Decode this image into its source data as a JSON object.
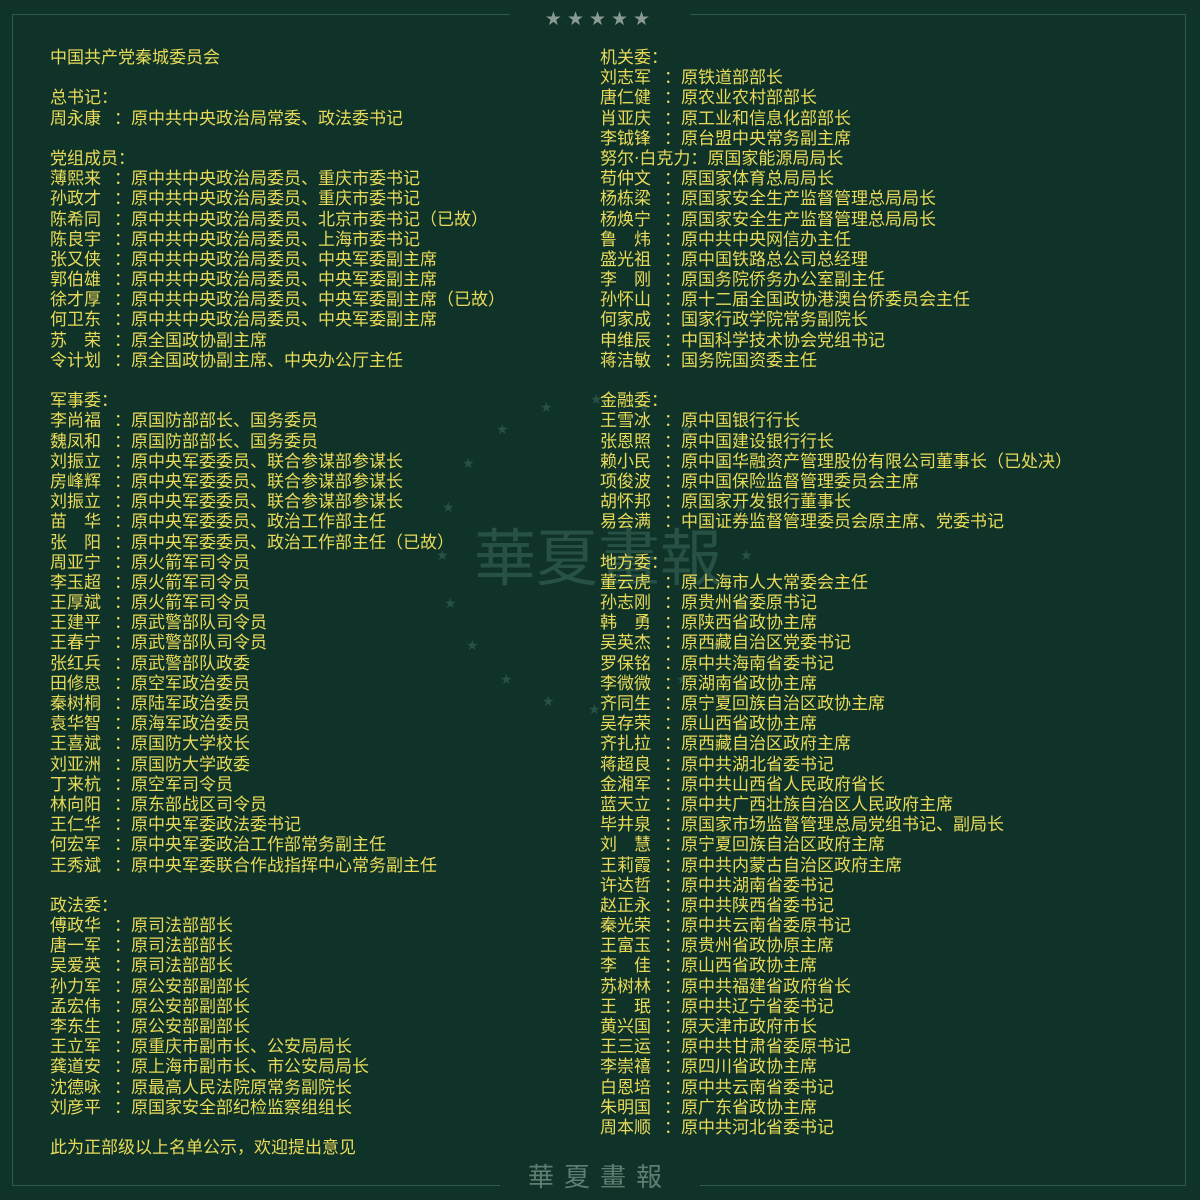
{
  "header": {
    "stars": "★★★★★"
  },
  "footer": {
    "logo_text": "華夏畫報"
  },
  "watermark": {
    "text": "華夏畫報"
  },
  "left": [
    {
      "type": "text",
      "text": "中国共产党秦城委员会"
    },
    {
      "type": "blank"
    },
    {
      "type": "heading",
      "text": "总书记："
    },
    {
      "type": "person",
      "name": "周永康",
      "title": "原中共中央政治局常委、政法委书记"
    },
    {
      "type": "blank"
    },
    {
      "type": "heading",
      "text": "党组成员："
    },
    {
      "type": "person",
      "name": "薄熙来",
      "title": "原中共中央政治局委员、重庆市委书记"
    },
    {
      "type": "person",
      "name": "孙政才",
      "title": "原中共中央政治局委员、重庆市委书记"
    },
    {
      "type": "person",
      "name": "陈希同",
      "title": "原中共中央政治局委员、北京市委书记（已故）"
    },
    {
      "type": "person",
      "name": "陈良宇",
      "title": "原中共中央政治局委员、上海市委书记"
    },
    {
      "type": "person",
      "name": "张又侠",
      "title": "原中共中央政治局委员、中央军委副主席"
    },
    {
      "type": "person",
      "name": "郭伯雄",
      "title": "原中共中央政治局委员、中央军委副主席"
    },
    {
      "type": "person",
      "name": "徐才厚",
      "title": "原中共中央政治局委员、中央军委副主席（已故）"
    },
    {
      "type": "person",
      "name": "何卫东",
      "title": "原中共中央政治局委员、中央军委副主席"
    },
    {
      "type": "person",
      "name": "苏　荣",
      "title": "原全国政协副主席"
    },
    {
      "type": "person",
      "name": "令计划",
      "title": "原全国政协副主席、中央办公厅主任"
    },
    {
      "type": "blank"
    },
    {
      "type": "heading",
      "text": "军事委："
    },
    {
      "type": "person",
      "name": "李尚福",
      "title": "原国防部部长、国务委员"
    },
    {
      "type": "person",
      "name": "魏凤和",
      "title": "原国防部部长、国务委员"
    },
    {
      "type": "person",
      "name": "刘振立",
      "title": "原中央军委委员、联合参谋部参谋长"
    },
    {
      "type": "person",
      "name": "房峰辉",
      "title": "原中央军委委员、联合参谋部参谋长"
    },
    {
      "type": "person",
      "name": "刘振立",
      "title": "原中央军委委员、联合参谋部参谋长"
    },
    {
      "type": "person",
      "name": "苗　华",
      "title": "原中央军委委员、政治工作部主任"
    },
    {
      "type": "person",
      "name": "张　阳",
      "title": "原中央军委委员、政治工作部主任（已故）"
    },
    {
      "type": "person",
      "name": "周亚宁",
      "title": "原火箭军司令员"
    },
    {
      "type": "person",
      "name": "李玉超",
      "title": "原火箭军司令员"
    },
    {
      "type": "person",
      "name": "王厚斌",
      "title": "原火箭军司令员"
    },
    {
      "type": "person",
      "name": "王建平",
      "title": "原武警部队司令员"
    },
    {
      "type": "person",
      "name": "王春宁",
      "title": "原武警部队司令员"
    },
    {
      "type": "person",
      "name": "张红兵",
      "title": "原武警部队政委"
    },
    {
      "type": "person",
      "name": "田修思",
      "title": "原空军政治委员"
    },
    {
      "type": "person",
      "name": "秦树桐",
      "title": "原陆军政治委员"
    },
    {
      "type": "person",
      "name": "袁华智",
      "title": "原海军政治委员"
    },
    {
      "type": "person",
      "name": "王喜斌",
      "title": "原国防大学校长"
    },
    {
      "type": "person",
      "name": "刘亚洲",
      "title": "原国防大学政委"
    },
    {
      "type": "person",
      "name": "丁来杭",
      "title": "原空军司令员"
    },
    {
      "type": "person",
      "name": "林向阳",
      "title": "原东部战区司令员"
    },
    {
      "type": "person",
      "name": "王仁华",
      "title": "原中央军委政法委书记"
    },
    {
      "type": "person",
      "name": "何宏军",
      "title": "原中央军委政治工作部常务副主任"
    },
    {
      "type": "person",
      "name": "王秀斌",
      "title": "原中央军委联合作战指挥中心常务副主任"
    },
    {
      "type": "blank"
    },
    {
      "type": "heading",
      "text": "政法委："
    },
    {
      "type": "person",
      "name": "傅政华",
      "title": "原司法部部长"
    },
    {
      "type": "person",
      "name": "唐一军",
      "title": "原司法部部长"
    },
    {
      "type": "person",
      "name": "吴爱英",
      "title": "原司法部部长"
    },
    {
      "type": "person",
      "name": "孙力军",
      "title": "原公安部副部长"
    },
    {
      "type": "person",
      "name": "孟宏伟",
      "title": "原公安部副部长"
    },
    {
      "type": "person",
      "name": "李东生",
      "title": "原公安部副部长"
    },
    {
      "type": "person",
      "name": "王立军",
      "title": "原重庆市副市长、公安局局长"
    },
    {
      "type": "person",
      "name": "龚道安",
      "title": "原上海市副市长、市公安局局长"
    },
    {
      "type": "person",
      "name": "沈德咏",
      "title": "原最高人民法院原常务副院长"
    },
    {
      "type": "person",
      "name": "刘彦平",
      "title": "原国家安全部纪检监察组组长"
    },
    {
      "type": "blank"
    },
    {
      "type": "text",
      "text": "此为正部级以上名单公示，欢迎提出意见"
    }
  ],
  "right": [
    {
      "type": "heading",
      "text": "机关委："
    },
    {
      "type": "person",
      "name": "刘志军",
      "title": "原铁道部部长"
    },
    {
      "type": "person",
      "name": "唐仁健",
      "title": "原农业农村部部长"
    },
    {
      "type": "person",
      "name": "肖亚庆",
      "title": "原工业和信息化部部长"
    },
    {
      "type": "person",
      "name": "李钺锋",
      "title": "原台盟中央常务副主席"
    },
    {
      "type": "person",
      "name": "努尔·白克力",
      "title": "原国家能源局局长"
    },
    {
      "type": "person",
      "name": "苟仲文",
      "title": "原国家体育总局局长"
    },
    {
      "type": "person",
      "name": "杨栋梁",
      "title": "原国家安全生产监督管理总局局长"
    },
    {
      "type": "person",
      "name": "杨焕宁",
      "title": "原国家安全生产监督管理总局局长"
    },
    {
      "type": "person",
      "name": "鲁　炜",
      "title": "原中共中央网信办主任"
    },
    {
      "type": "person",
      "name": "盛光祖",
      "title": "原中国铁路总公司总经理"
    },
    {
      "type": "person",
      "name": "李　刚",
      "title": "原国务院侨务办公室副主任"
    },
    {
      "type": "person",
      "name": "孙怀山",
      "title": "原十二届全国政协港澳台侨委员会主任"
    },
    {
      "type": "person",
      "name": "何家成",
      "title": "国家行政学院常务副院长"
    },
    {
      "type": "person",
      "name": "申维辰",
      "title": "中国科学技术协会党组书记"
    },
    {
      "type": "person",
      "name": "蒋洁敏",
      "title": "国务院国资委主任"
    },
    {
      "type": "blank"
    },
    {
      "type": "heading",
      "text": "金融委："
    },
    {
      "type": "person",
      "name": "王雪冰",
      "title": "原中国银行行长"
    },
    {
      "type": "person",
      "name": "张恩照",
      "title": "原中国建设银行行长"
    },
    {
      "type": "person",
      "name": "赖小民",
      "title": "原中国华融资产管理股份有限公司董事长（已处决）"
    },
    {
      "type": "person",
      "name": "项俊波",
      "title": "原中国保险监督管理委员会主席"
    },
    {
      "type": "person",
      "name": "胡怀邦",
      "title": "原国家开发银行董事长"
    },
    {
      "type": "person",
      "name": "易会满",
      "title": "中国证券监督管理委员会原主席、党委书记"
    },
    {
      "type": "blank"
    },
    {
      "type": "heading",
      "text": "地方委："
    },
    {
      "type": "person",
      "name": "董云虎",
      "title": "原上海市人大常委会主任"
    },
    {
      "type": "person",
      "name": "孙志刚",
      "title": "原贵州省委原书记"
    },
    {
      "type": "person",
      "name": "韩　勇",
      "title": "原陕西省政协主席"
    },
    {
      "type": "person",
      "name": "吴英杰",
      "title": "原西藏自治区党委书记"
    },
    {
      "type": "person",
      "name": "罗保铭",
      "title": "原中共海南省委书记"
    },
    {
      "type": "person",
      "name": "李微微",
      "title": "原湖南省政协主席"
    },
    {
      "type": "person",
      "name": "齐同生",
      "title": "原宁夏回族自治区政协主席"
    },
    {
      "type": "person",
      "name": "吴存荣",
      "title": "原山西省政协主席"
    },
    {
      "type": "person",
      "name": "齐扎拉",
      "title": "原西藏自治区政府主席"
    },
    {
      "type": "person",
      "name": "蒋超良",
      "title": "原中共湖北省委书记"
    },
    {
      "type": "person",
      "name": "金湘军",
      "title": "原中共山西省人民政府省长"
    },
    {
      "type": "person",
      "name": "蓝天立",
      "title": "原中共广西壮族自治区人民政府主席"
    },
    {
      "type": "person",
      "name": "毕井泉",
      "title": "原国家市场监督管理总局党组书记、副局长"
    },
    {
      "type": "person",
      "name": "刘　慧",
      "title": "原宁夏回族自治区政府主席"
    },
    {
      "type": "person",
      "name": "王莉霞",
      "title": "原中共内蒙古自治区政府主席"
    },
    {
      "type": "person",
      "name": "许达哲",
      "title": "原中共湖南省委书记"
    },
    {
      "type": "person",
      "name": "赵正永",
      "title": "原中共陕西省委书记"
    },
    {
      "type": "person",
      "name": "秦光荣",
      "title": "原中共云南省委原书记"
    },
    {
      "type": "person",
      "name": "王富玉",
      "title": "原贵州省政协原主席"
    },
    {
      "type": "person",
      "name": "李　佳",
      "title": "原山西省政协主席"
    },
    {
      "type": "person",
      "name": "苏树林",
      "title": "原中共福建省政府省长"
    },
    {
      "type": "person",
      "name": "王　珉",
      "title": "原中共辽宁省委书记"
    },
    {
      "type": "person",
      "name": "黄兴国",
      "title": "原天津市政府市长"
    },
    {
      "type": "person",
      "name": "王三运",
      "title": "原中共甘肃省委原书记"
    },
    {
      "type": "person",
      "name": "李崇禧",
      "title": "原四川省政协主席"
    },
    {
      "type": "person",
      "name": "白恩培",
      "title": "原中共云南省委书记"
    },
    {
      "type": "person",
      "name": "朱明国",
      "title": "原广东省政协主席"
    },
    {
      "type": "person",
      "name": "周本顺",
      "title": "原中共河北省委书记"
    }
  ]
}
